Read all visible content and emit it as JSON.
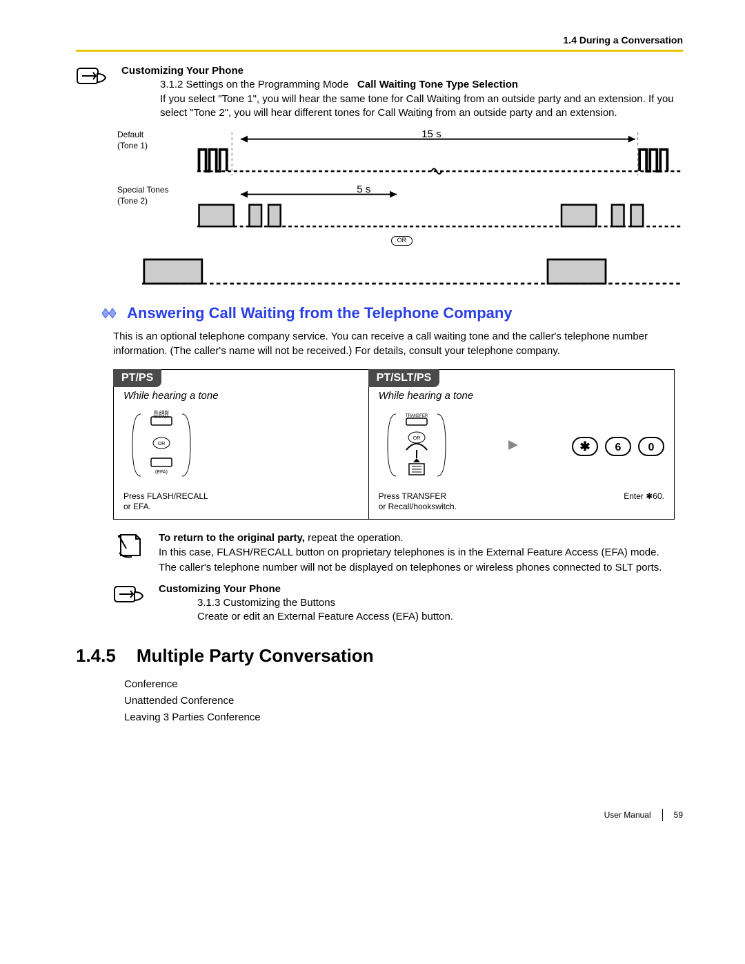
{
  "header": {
    "breadcrumb": "1.4 During a Conversation"
  },
  "custom1": {
    "title": "Customizing Your Phone",
    "ref": "3.1.2 Settings on the Programming Mode",
    "ref_bold": "Call Waiting Tone Type Selection",
    "para": "If you select \"Tone 1\", you will hear the same tone for Call Waiting from an outside party and an extension. If you select \"Tone 2\", you will hear different tones for Call Waiting from an outside party and an extension."
  },
  "tone_fig": {
    "label1_a": "Default",
    "label1_b": "(Tone 1)",
    "time1": "15 s",
    "label2_a": "Special Tones",
    "label2_b": "(Tone 2)",
    "time2": "5 s",
    "or": "OR"
  },
  "answering": {
    "title": "Answering Call Waiting from the Telephone Company",
    "para": "This is an optional telephone company service. You can receive a call waiting tone and the caller's telephone number information. (The caller's name will not be received.) For details, consult your telephone company."
  },
  "panel": {
    "left_tab": "PT/PS",
    "left_sub": "While hearing a tone",
    "left_btn_top": "FLASH/\nRECALL",
    "left_btn_bot": "(EFA)",
    "left_or": "OR",
    "left_caption_a": "Press FLASH/RECALL",
    "left_caption_b": "or EFA.",
    "right_tab": "PT/SLT/PS",
    "right_sub": "While hearing a tone",
    "right_btn_top": "TRANSFER",
    "right_or": "OR",
    "right_caption_a": "Press TRANSFER",
    "right_caption_b": "or Recall/hookswitch.",
    "right_enter": "Enter    60.",
    "key_star": "✱",
    "key_6": "6",
    "key_0": "0",
    "right_enter_full": "Enter ✱60."
  },
  "notes": {
    "line1_bold": "To return to the original party,",
    "line1_rest": " repeat the operation.",
    "line2": "In this case, FLASH/RECALL button on proprietary telephones is in the External Feature Access (EFA) mode.",
    "line3": "The caller's telephone number will not be displayed on telephones or wireless phones connected to SLT ports."
  },
  "custom2": {
    "title": "Customizing Your Phone",
    "line1": "3.1.3 Customizing the Buttons",
    "line2": "Create or edit an External Feature Access (EFA) button."
  },
  "section": {
    "num": "1.4.5",
    "title": "Multiple Party Conversation",
    "items": [
      "Conference",
      "Unattended Conference",
      "Leaving 3 Parties Conference"
    ]
  },
  "footer": {
    "label": "User Manual",
    "page": "59"
  }
}
